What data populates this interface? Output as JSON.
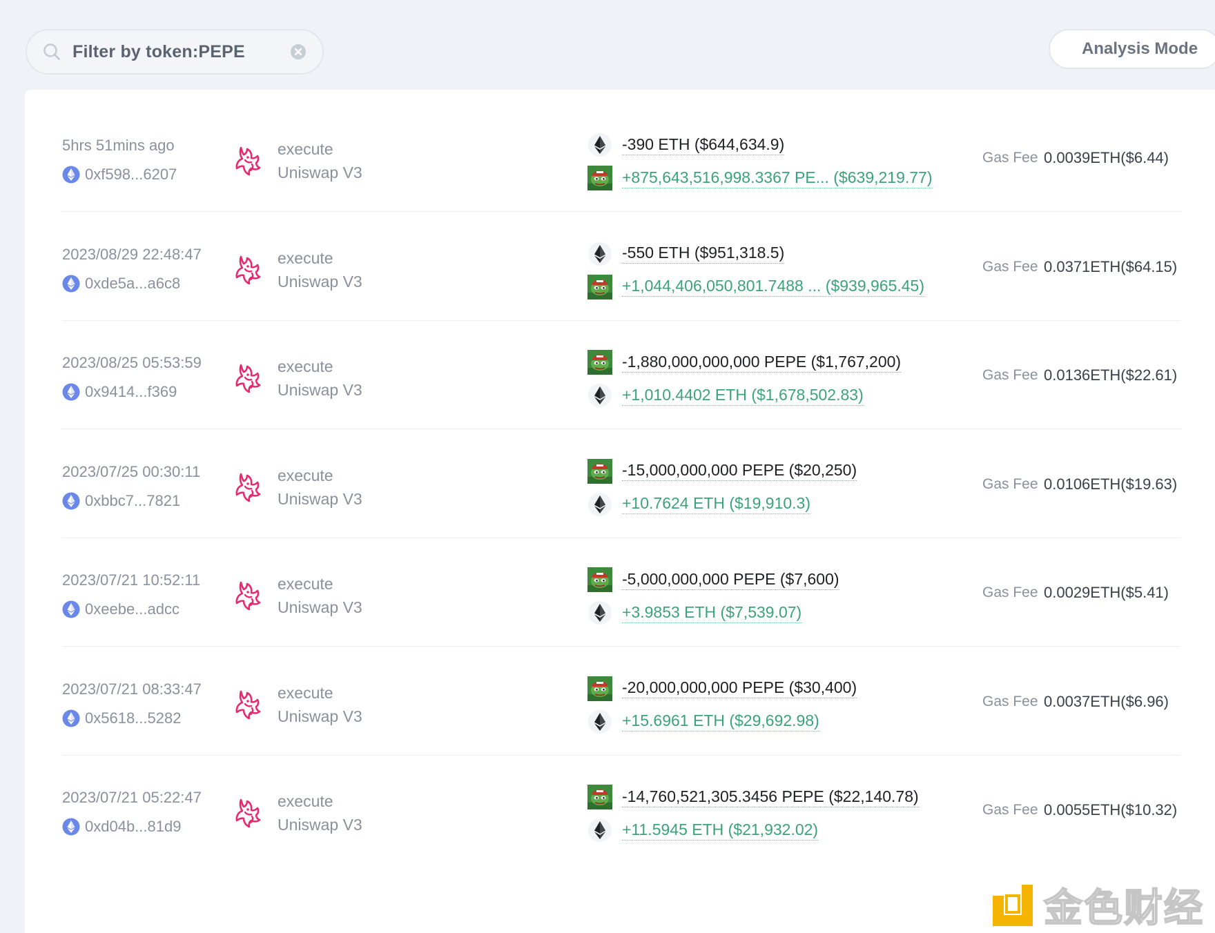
{
  "search": {
    "value": "Filter by token:PEPE"
  },
  "toolbar": {
    "analysis_mode_label": "Analysis Mode"
  },
  "gas_label": "Gas Fee",
  "colors": {
    "positive": "#3aa37a",
    "negative": "#1e1f24",
    "uniswap_pink": "#e8296f",
    "chain_blue": "#5f7de8"
  },
  "transactions": [
    {
      "time": "5hrs 51mins ago",
      "hash": "0xf598...6207",
      "method": "execute",
      "protocol": "Uniswap V3",
      "out": {
        "token_icon": "eth-icon",
        "amount": "-390 ETH ($644,634.9)"
      },
      "in": {
        "token_icon": "pepe-icon",
        "amount": "+875,643,516,998.3367 PE...  ($639,219.77)"
      },
      "gas_fee": "0.0039ETH($6.44)"
    },
    {
      "time": "2023/08/29 22:48:47",
      "hash": "0xde5a...a6c8",
      "method": "execute",
      "protocol": "Uniswap V3",
      "out": {
        "token_icon": "eth-icon",
        "amount": "-550 ETH ($951,318.5)"
      },
      "in": {
        "token_icon": "pepe-icon",
        "amount": "+1,044,406,050,801.7488 ...  ($939,965.45)"
      },
      "gas_fee": "0.0371ETH($64.15)"
    },
    {
      "time": "2023/08/25 05:53:59",
      "hash": "0x9414...f369",
      "method": "execute",
      "protocol": "Uniswap V3",
      "out": {
        "token_icon": "pepe-icon",
        "amount": "-1,880,000,000,000 PEPE ($1,767,200)"
      },
      "in": {
        "token_icon": "eth-icon",
        "amount": "+1,010.4402 ETH ($1,678,502.83)"
      },
      "gas_fee": "0.0136ETH($22.61)"
    },
    {
      "time": "2023/07/25 00:30:11",
      "hash": "0xbbc7...7821",
      "method": "execute",
      "protocol": "Uniswap V3",
      "out": {
        "token_icon": "pepe-icon",
        "amount": "-15,000,000,000 PEPE ($20,250)"
      },
      "in": {
        "token_icon": "eth-icon",
        "amount": "+10.7624 ETH ($19,910.3)"
      },
      "gas_fee": "0.0106ETH($19.63)"
    },
    {
      "time": "2023/07/21 10:52:11",
      "hash": "0xeebe...adcc",
      "method": "execute",
      "protocol": "Uniswap V3",
      "out": {
        "token_icon": "pepe-icon",
        "amount": "-5,000,000,000 PEPE ($7,600)"
      },
      "in": {
        "token_icon": "eth-icon",
        "amount": "+3.9853 ETH ($7,539.07)"
      },
      "gas_fee": "0.0029ETH($5.41)"
    },
    {
      "time": "2023/07/21 08:33:47",
      "hash": "0x5618...5282",
      "method": "execute",
      "protocol": "Uniswap V3",
      "out": {
        "token_icon": "pepe-icon",
        "amount": "-20,000,000,000 PEPE ($30,400)"
      },
      "in": {
        "token_icon": "eth-icon",
        "amount": "+15.6961 ETH ($29,692.98)"
      },
      "gas_fee": "0.0037ETH($6.96)"
    },
    {
      "time": "2023/07/21 05:22:47",
      "hash": "0xd04b...81d9",
      "method": "execute",
      "protocol": "Uniswap V3",
      "out": {
        "token_icon": "pepe-icon",
        "amount": "-14,760,521,305.3456 PEPE ($22,140.78)"
      },
      "in": {
        "token_icon": "eth-icon",
        "amount": "+11.5945 ETH ($21,932.02)"
      },
      "gas_fee": "0.0055ETH($10.32)"
    }
  ],
  "watermark": {
    "text": "金色财经"
  }
}
